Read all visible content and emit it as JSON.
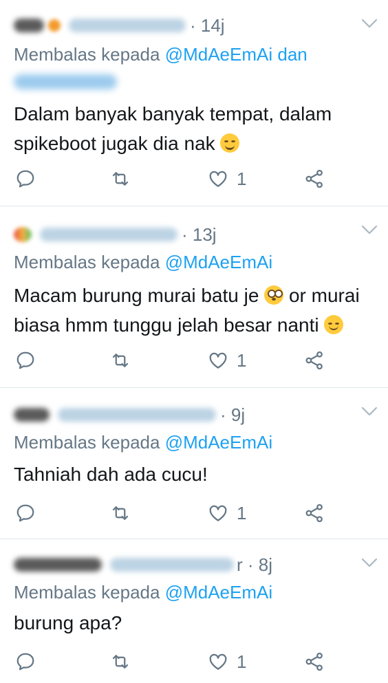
{
  "tweets": [
    {
      "time": "14j",
      "reply_prefix": "Membalas kepada",
      "reply_mention": "@MdAeEmAi",
      "reply_suffix": "dan",
      "text_line1": "Dalam banyak banyak tempat, dalam",
      "text_line2": "spikeboot jugak dia nak",
      "like_count": "1"
    },
    {
      "time": "13j",
      "reply_prefix": "Membalas kepada",
      "reply_mention": "@MdAeEmAi",
      "text_line1a": "Macam burung murai batu je",
      "text_line1b": "or murai",
      "text_line2": "biasa hmm tunggu jelah besar nanti",
      "like_count": "1"
    },
    {
      "time": "9j",
      "reply_prefix": "Membalas kepada",
      "reply_mention": "@MdAeEmAi",
      "text_line1": "Tahniah dah ada cucu!",
      "like_count": "1"
    },
    {
      "time": "8j",
      "handle_visible_suffix": "r",
      "reply_prefix": "Membalas kepada",
      "reply_mention": "@MdAeEmAi",
      "text_line1": "burung apa?",
      "like_count": "1"
    }
  ],
  "icons": {
    "reply": "reply-icon",
    "retweet": "retweet-icon",
    "like": "heart-icon",
    "share": "share-icon",
    "menu": "chevron-down-icon"
  },
  "colors": {
    "text": "#14171a",
    "secondary": "#657786",
    "mention": "#1da1f2",
    "divider": "#e1e8ed"
  }
}
